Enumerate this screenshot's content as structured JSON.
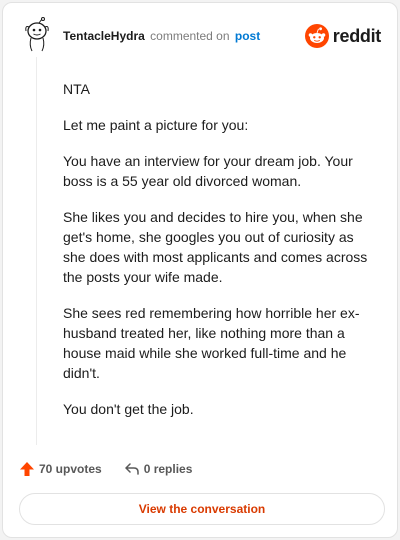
{
  "comment": {
    "username": "TentacleHydra",
    "action_text": "commented on",
    "post_link_text": "post",
    "paragraphs": [
      "NTA",
      "Let me paint a picture for you:",
      "You have an interview for your dream job. Your boss is a 55 year old divorced woman.",
      "She likes you and decides to hire you, when she get's home, she googles you out of curiosity as she does with most applicants and comes across the posts your wife made.",
      "She sees red remembering how horrible her ex-husband treated her, like nothing more than a house maid while she worked full-time and he didn't.",
      "You don't get the job."
    ]
  },
  "brand": {
    "wordmark": "reddit",
    "logo_icon": "reddit-snoo-icon",
    "color": "#ff4500"
  },
  "footer": {
    "upvotes_label": "70 upvotes",
    "upvote_icon": "upvote-arrow-icon",
    "upvote_color": "#ff4500",
    "replies_label": "0 replies",
    "reply_icon": "reply-arrow-icon",
    "cta_label": "View the conversation",
    "cta_color": "#d93a00"
  },
  "avatar": {
    "icon": "snoo-avatar-icon"
  }
}
